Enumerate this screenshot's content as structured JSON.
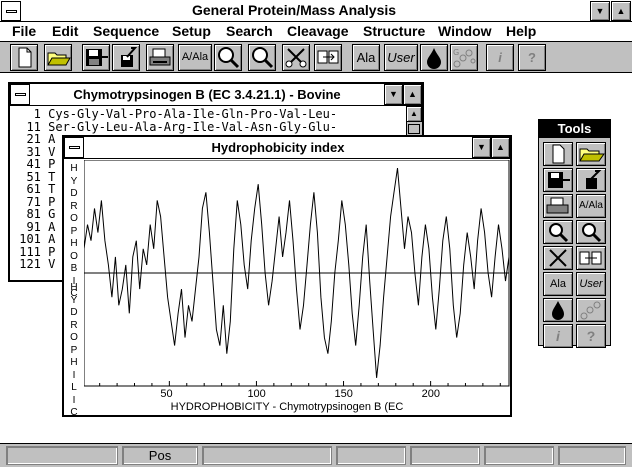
{
  "app": {
    "title": "General Protein/Mass Analysis"
  },
  "menu": [
    "File",
    "Edit",
    "Sequence",
    "Setup",
    "Search",
    "Cleavage",
    "Structure",
    "Window",
    "Help"
  ],
  "toolbar": {
    "ala_label": "A/Ala",
    "ala2_label": "Ala",
    "user_label": "User",
    "info_label": "i",
    "help_label": "?"
  },
  "sequence_window": {
    "title": "Chymotrypsinogen B (EC 3.4.21.1) - Bovine",
    "lines": [
      {
        "num": "1",
        "text": "Cys-Gly-Val-Pro-Ala-Ile-Gln-Pro-Val-Leu-"
      },
      {
        "num": "11",
        "text": "Ser-Gly-Leu-Ala-Arg-Ile-Val-Asn-Gly-Glu-"
      },
      {
        "num": "21",
        "text": "A"
      },
      {
        "num": "31",
        "text": "V"
      },
      {
        "num": "41",
        "text": "P"
      },
      {
        "num": "51",
        "text": "T"
      },
      {
        "num": "61",
        "text": "T"
      },
      {
        "num": "71",
        "text": "P"
      },
      {
        "num": "81",
        "text": "G"
      },
      {
        "num": "91",
        "text": "A"
      },
      {
        "num": "101",
        "text": "A"
      },
      {
        "num": "111",
        "text": "P"
      },
      {
        "num": "121",
        "text": "V"
      }
    ]
  },
  "hydro_window": {
    "title": "Hydrophobicity index",
    "ylabel_top": "HYDROPHOBIC",
    "ylabel_bottom": "HYDROPHILIC",
    "xlabel": "HYDROPHOBICITY - Chymotrypsinogen B (EC"
  },
  "chart_data": {
    "type": "line",
    "xlabel": "HYDROPHOBICITY - Chymotrypsinogen B (EC",
    "ylabel": "HYDROPHOBIC / HYDROPHILIC",
    "xlim": [
      1,
      245
    ],
    "ylim": [
      -1.4,
      1.4
    ],
    "xticks": [
      50,
      100,
      150,
      200
    ],
    "baseline": 0,
    "series": [
      {
        "x": [
          1,
          3,
          5,
          7,
          9,
          11,
          13,
          15,
          17,
          19,
          21,
          23,
          25,
          27,
          29,
          31,
          33,
          35,
          37,
          39,
          41,
          43,
          45,
          47,
          49,
          51,
          53,
          55,
          57,
          59,
          61,
          63,
          65,
          67,
          69,
          71,
          73,
          75,
          77,
          79,
          81,
          83,
          85,
          87,
          89,
          91,
          93,
          95,
          97,
          99,
          101,
          103,
          105,
          107,
          109,
          111,
          113,
          115,
          117,
          119,
          121,
          123,
          125,
          127,
          129,
          131,
          133,
          135,
          137,
          139,
          141,
          143,
          145,
          147,
          149,
          151,
          153,
          155,
          157,
          159,
          161,
          163,
          165,
          167,
          169,
          171,
          173,
          175,
          177,
          179,
          181,
          183,
          185,
          187,
          189,
          191,
          193,
          195,
          197,
          199,
          201,
          203,
          205,
          207,
          209,
          211,
          213,
          215,
          217,
          219,
          221,
          223,
          225,
          227,
          229,
          231,
          233,
          235,
          237,
          239,
          241,
          243,
          245
        ],
        "y": [
          0.3,
          0.6,
          0.4,
          0.8,
          0.5,
          0.9,
          0.4,
          0.1,
          -0.3,
          0.2,
          -0.4,
          -0.2,
          0.1,
          -0.5,
          0.2,
          0.4,
          -0.2,
          0.3,
          0.1,
          0.6,
          0.3,
          0.9,
          0.7,
          0.2,
          -0.3,
          -0.6,
          -0.9,
          -0.5,
          -0.2,
          -0.8,
          -0.4,
          -0.6,
          -0.2,
          0.2,
          0.8,
          1.0,
          0.5,
          -0.1,
          -0.7,
          -0.9,
          -0.4,
          -1.0,
          -0.6,
          0.3,
          0.9,
          0.6,
          0.1,
          -0.2,
          0.4,
          0.8,
          1.1,
          0.6,
          0.0,
          -0.4,
          -0.1,
          0.3,
          0.7,
          0.2,
          0.5,
          0.9,
          0.4,
          -0.2,
          -0.7,
          -0.4,
          0.1,
          0.6,
          1.0,
          0.5,
          -0.3,
          -0.8,
          -1.0,
          -0.6,
          0.0,
          0.4,
          0.9,
          0.6,
          0.1,
          -0.5,
          -0.9,
          -0.4,
          0.2,
          0.6,
          -0.1,
          -0.7,
          -1.3,
          -0.9,
          -0.3,
          0.2,
          0.7,
          1.0,
          1.3,
          0.8,
          0.3,
          0.7,
          0.5,
          0.0,
          -0.4,
          0.2,
          0.6,
          0.3,
          -0.3,
          -0.7,
          -0.2,
          0.4,
          0.7,
          0.3,
          -0.4,
          -0.8,
          -0.5,
          0.1,
          0.5,
          0.2,
          -0.2,
          0.4,
          0.8,
          0.5,
          0.0,
          -0.3,
          0.2,
          0.6,
          0.3,
          -0.1,
          0.2
        ]
      }
    ]
  },
  "status": {
    "pos_label": "Pos"
  }
}
